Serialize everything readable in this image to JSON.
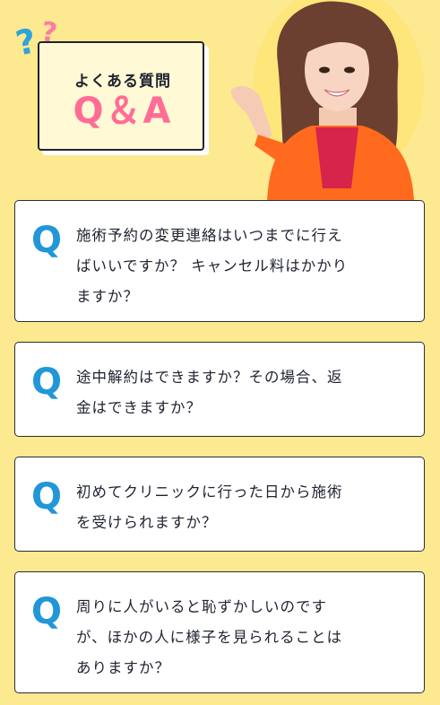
{
  "header": {
    "title": "よくある質問",
    "qa": "Q＆A"
  },
  "faq": {
    "items": [
      {
        "q": "Q",
        "text": "施術予約の変更連絡はいつまでに行え\nばいいですか？ キャンセル料はかかり\nますか？"
      },
      {
        "q": "Q",
        "text": "途中解約はできますか？その場合、返\n金はできますか？"
      },
      {
        "q": "Q",
        "text": "初めてクリニックに行った日から施術\nを受けられますか？"
      },
      {
        "q": "Q",
        "text": "周りに人がいると恥ずかしいのです\nが、ほかの人に様子を見られることは\nありますか？"
      }
    ]
  },
  "colors": {
    "background": "#fde98f",
    "q_icon": "#2196d8",
    "qa_pink": "#ff6d96",
    "qmark_blue": "#2ea3dc",
    "qmark_pink": "#ff7aa6"
  }
}
